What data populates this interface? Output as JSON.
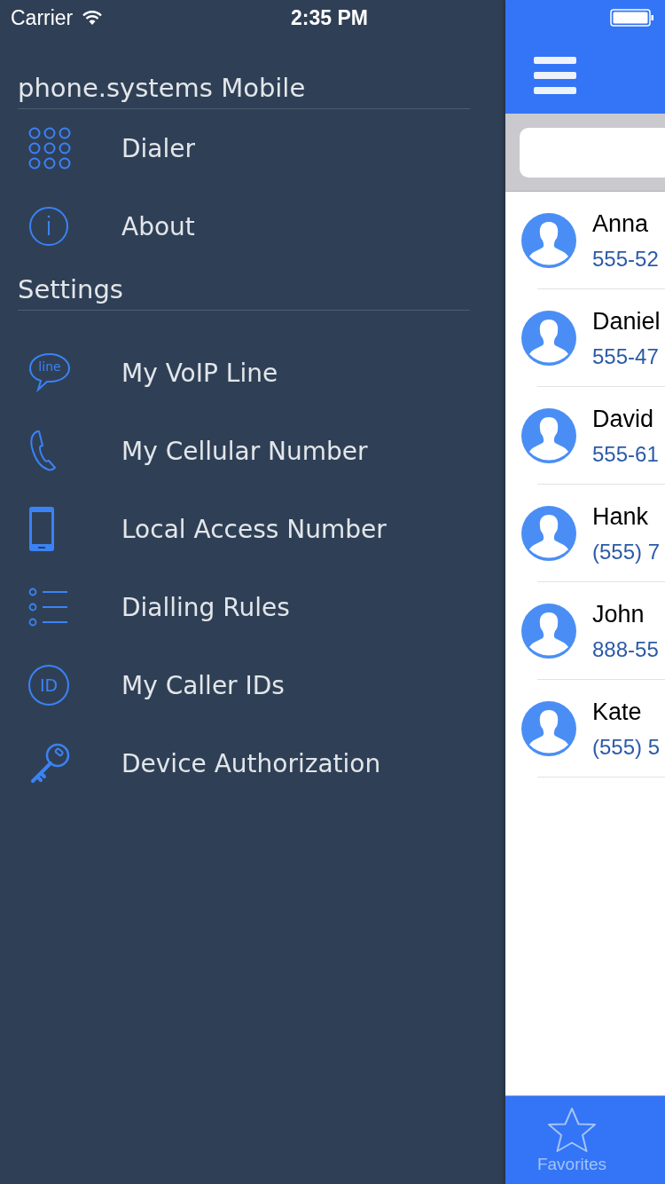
{
  "status_bar": {
    "carrier": "Carrier",
    "time": "2:35 PM"
  },
  "menu": {
    "title": "phone.systems Mobile",
    "items": [
      {
        "kind": "keypad",
        "label": "Dialer"
      },
      {
        "kind": "info",
        "label": "About"
      }
    ],
    "settings_title": "Settings",
    "settings_items": [
      {
        "kind": "chat",
        "label": "My VoIP Line",
        "icon_text": "line"
      },
      {
        "kind": "phone",
        "label": "My Cellular Number"
      },
      {
        "kind": "mobile",
        "label": "Local Access Number"
      },
      {
        "kind": "list",
        "label": "Dialling Rules"
      },
      {
        "kind": "id",
        "label": "My Caller IDs",
        "icon_text": "ID"
      },
      {
        "kind": "key",
        "label": "Device Authorization"
      }
    ]
  },
  "contacts": {
    "rows": [
      {
        "name": "Anna",
        "phone": "555-52"
      },
      {
        "name": "Daniel",
        "phone": "555-47"
      },
      {
        "name": "David",
        "phone": "555-61"
      },
      {
        "name": "Hank",
        "phone": "(555) 7"
      },
      {
        "name": "John",
        "phone": "888-55"
      },
      {
        "name": "Kate",
        "phone": "(555) 5"
      }
    ]
  },
  "tab_bar": {
    "tabs": [
      {
        "label": "Favorites",
        "selected": false
      }
    ]
  }
}
